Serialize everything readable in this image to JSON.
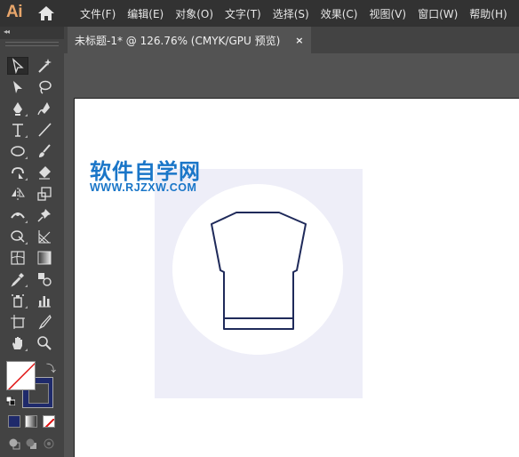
{
  "app": {
    "logo_text": "Ai"
  },
  "menu": [
    "文件(F)",
    "编辑(E)",
    "对象(O)",
    "文字(T)",
    "选择(S)",
    "效果(C)",
    "视图(V)",
    "窗口(W)",
    "帮助(H)"
  ],
  "document_tab": {
    "title": "未标题-1* @ 126.76% (CMYK/GPU 预览)",
    "close_label": "×"
  },
  "toolbar": {
    "collapse_label": "◂◂",
    "tools": [
      "selection-tool",
      "magic-wand-tool",
      "direct-selection-tool",
      "lasso-tool",
      "pen-tool",
      "curvature-tool",
      "type-tool",
      "line-segment-tool",
      "ellipse-tool",
      "paintbrush-tool",
      "shaper-tool",
      "eraser-tool",
      "reflect-tool",
      "scale-tool",
      "width-tool",
      "puppet-warp-tool",
      "shape-builder-tool",
      "perspective-grid-tool",
      "mesh-tool",
      "gradient-tool",
      "eyedropper-tool",
      "blend-tool",
      "symbol-sprayer-tool",
      "column-graph-tool",
      "artboard-tool",
      "slice-tool",
      "hand-tool",
      "zoom-tool"
    ]
  },
  "colors": {
    "fill": "#ffffff",
    "stroke": "#1f2a6b",
    "accent": "#1a76c8",
    "illustration_bg": "#eeeef8",
    "outline": "#1f2a5a"
  },
  "watermark": {
    "title": "软件自学网",
    "url": "WWW.RJZXW.COM"
  }
}
